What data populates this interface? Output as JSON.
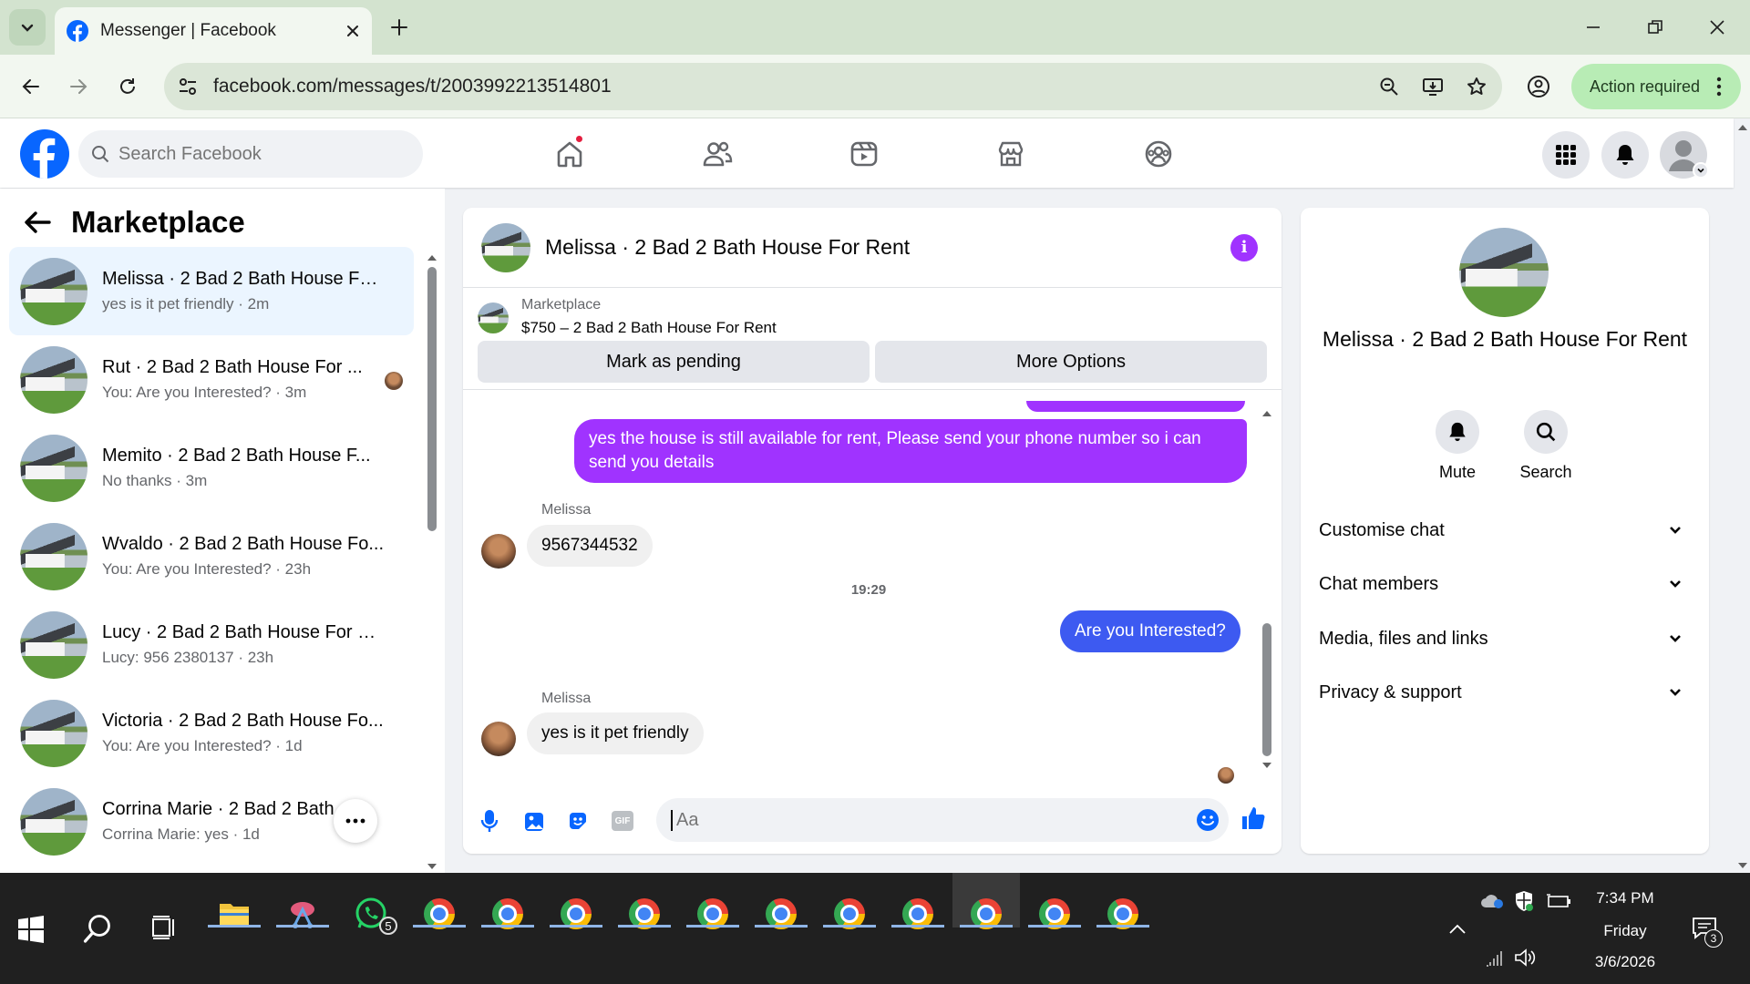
{
  "browser": {
    "tab_title": "Messenger | Facebook",
    "url": "facebook.com/messages/t/2003992213514801",
    "action_required": "Action required"
  },
  "fb": {
    "search_placeholder": "Search Facebook"
  },
  "left": {
    "title": "Marketplace",
    "conversations": [
      {
        "name": "Melissa · 2 Bad 2 Bath House Fo...",
        "preview": "yes is it pet friendly · 2m"
      },
      {
        "name": "Rut · 2 Bad 2 Bath House For ...",
        "preview": "You: Are you Interested? · 3m"
      },
      {
        "name": "Memito · 2 Bad 2 Bath House F...",
        "preview": "No thanks · 3m"
      },
      {
        "name": "Wvaldo · 2 Bad 2 Bath House Fo...",
        "preview": "You: Are you Interested? · 23h"
      },
      {
        "name": "Lucy · 2 Bad 2 Bath House For R...",
        "preview": "Lucy: 956 2380137 · 23h"
      },
      {
        "name": "Victoria · 2 Bad 2 Bath House Fo...",
        "preview": "You: Are you Interested? · 1d"
      },
      {
        "name": "Corrina Marie · 2 Bad 2 Bath ...",
        "preview": "Corrina Marie: yes · 1d"
      }
    ]
  },
  "chat": {
    "title": "Melissa · 2 Bad 2 Bath House For Rent",
    "listing_label": "Marketplace",
    "listing_price": "$750 – 2 Bad 2 Bath House For Rent",
    "mark_pending": "Mark as pending",
    "more_options": "More Options",
    "msg_out_1": "yes the house is still available for rent, Please send your phone number so i can send you details",
    "sender_1": "Melissa",
    "msg_in_1": "9567344532",
    "time_1": "19:29",
    "msg_out_2": "Are you Interested?",
    "sender_2": "Melissa",
    "msg_in_2": "yes is it pet friendly",
    "composer_placeholder": "Aa",
    "gif_label": "GIF"
  },
  "info": {
    "name": "Melissa · 2 Bad 2 Bath House For Rent",
    "mute": "Mute",
    "search": "Search",
    "rows": [
      "Customise chat",
      "Chat members",
      "Media, files and links",
      "Privacy & support"
    ]
  },
  "taskbar": {
    "whatsapp_badge": "5",
    "time": "7:34 PM",
    "day": "Friday",
    "date": "3/6/2026",
    "notif_count": "3"
  },
  "colors": {
    "fb_blue": "#0866ff",
    "messenger_purple": "#a033ff",
    "out_bubble_blue": "#3d5af1"
  }
}
